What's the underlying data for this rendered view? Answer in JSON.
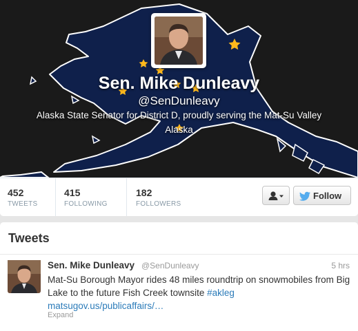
{
  "profile": {
    "name": "Sen. Mike Dunleavy",
    "handle": "@SenDunleavy",
    "bio_line1": "Alaska State Senator for District D, proudly serving the Mat-Su Valley",
    "bio_line2": "Alaska"
  },
  "stats": [
    {
      "value": "452",
      "label": "TWEETS"
    },
    {
      "value": "415",
      "label": "FOLLOWING"
    },
    {
      "value": "182",
      "label": "FOLLOWERS"
    }
  ],
  "actions": {
    "follow_label": "Follow",
    "user_menu_icon": "user-dropdown-icon",
    "follow_icon": "bird-icon"
  },
  "tweets_section": {
    "title": "Tweets",
    "items": [
      {
        "name": "Sen. Mike Dunleavy",
        "handle": "@SenDunleavy",
        "time": "5 hrs",
        "text_before": "Mat-Su Borough Mayor rides 48 miles roundtrip on snowmobiles from Big Lake to the future Fish Creek townsite ",
        "hashtag": "#akleg",
        "link": "matsugov.us/publicaffairs/…",
        "expand_label": "Expand"
      }
    ]
  },
  "colors": {
    "header_bg": "#1a1a1a",
    "flag_blue": "#0f204b",
    "star_gold": "#ffb81c",
    "link_blue": "#2b7bb9",
    "follow_bird": "#55acee"
  }
}
